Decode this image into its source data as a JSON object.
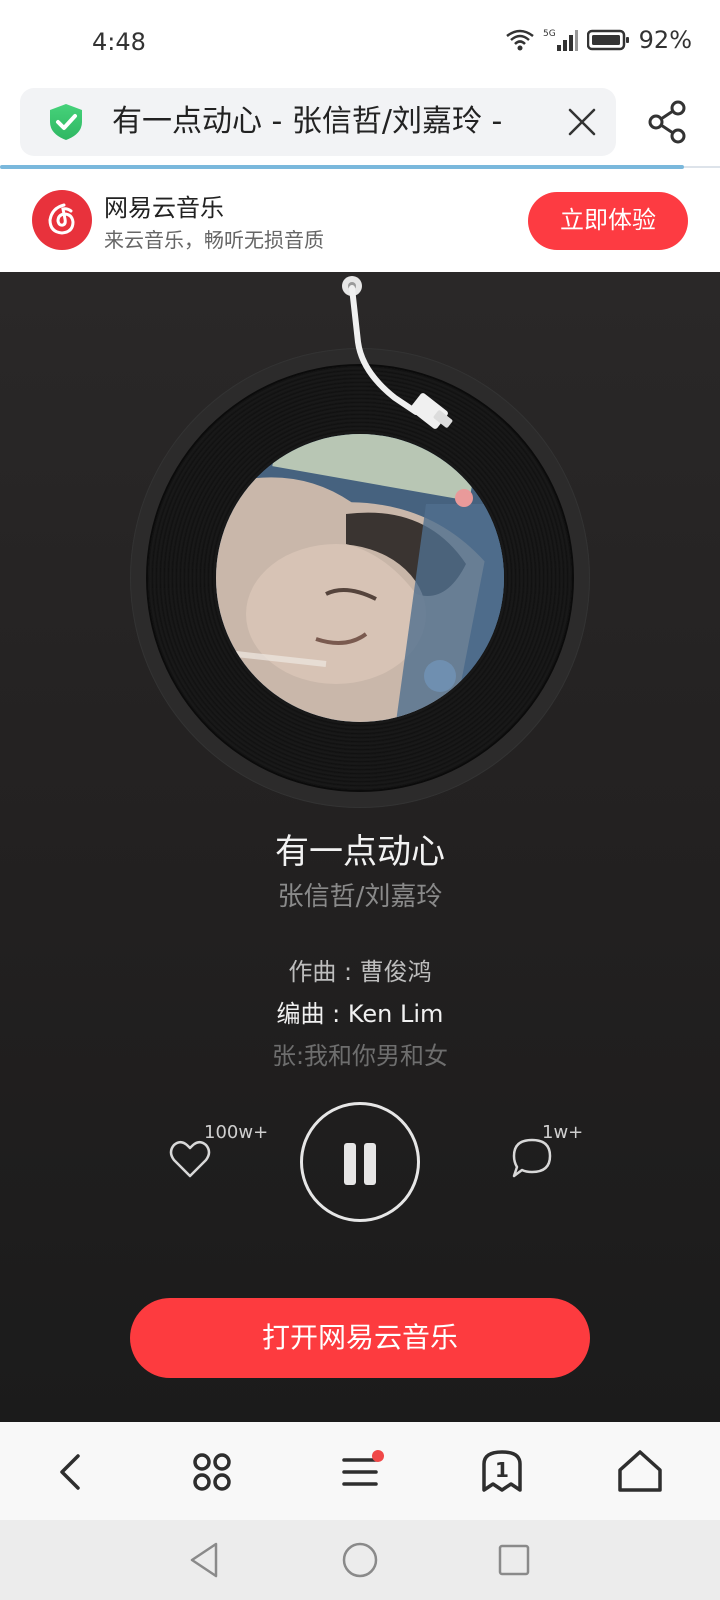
{
  "status_bar": {
    "time": "4:48",
    "battery": "92%"
  },
  "address_bar": {
    "url_title": "有一点动心 - 张信哲/刘嘉玲 -"
  },
  "app_banner": {
    "name": "网易云音乐",
    "description": "来云音乐，畅听无损音质",
    "button": "立即体验"
  },
  "player": {
    "title": "有一点动心",
    "artist": "张信哲/刘嘉玲",
    "lyrics": [
      "作曲 : 曹俊鸿",
      "编曲 : Ken Lim",
      "张:我和你男和女"
    ],
    "like_count": "100w+",
    "comment_count": "1w+",
    "open_button": "打开网易云音乐"
  },
  "browser_nav": {
    "tab_count": "1"
  }
}
